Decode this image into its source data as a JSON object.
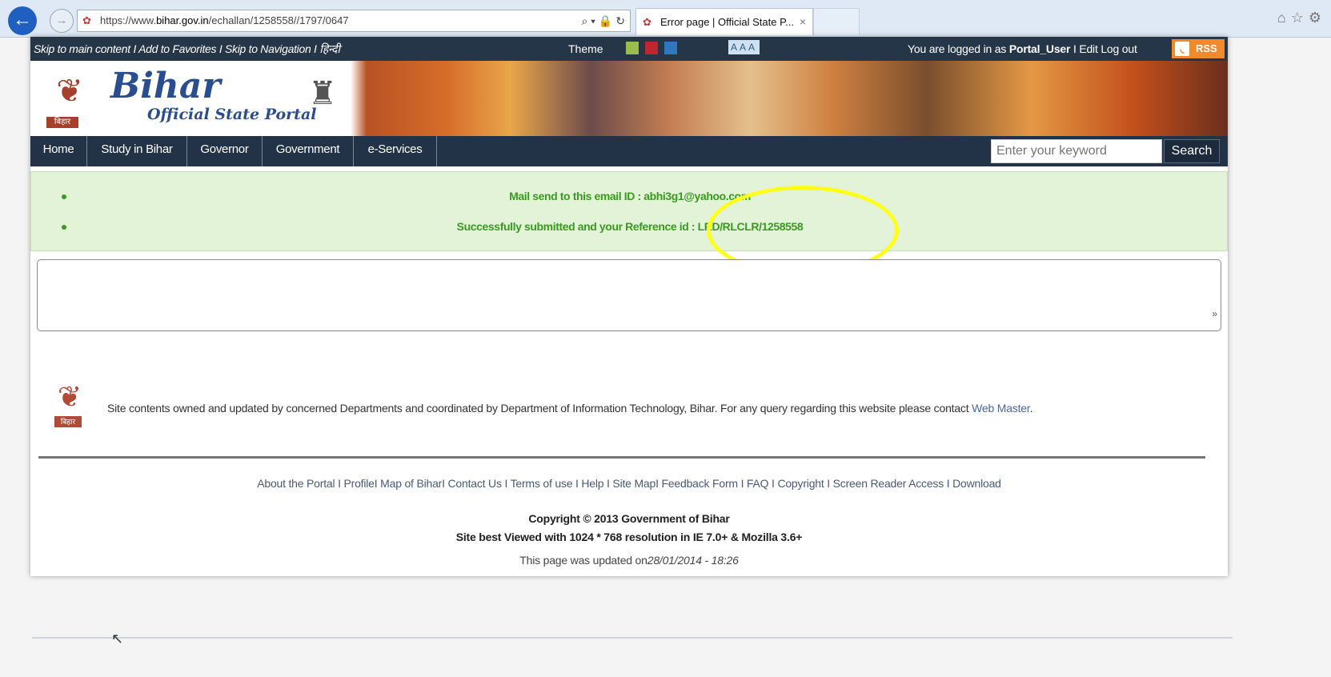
{
  "browser": {
    "url_prefix": "https://www.",
    "url_domain": "bihar.gov.in",
    "url_path": "/echallan/1258558//1797/0647",
    "tab_title": "Error page | Official State P...",
    "tab_close": "×",
    "back_icon": "arrow-left-icon",
    "address_tools": "⌕ ▾ 🔒 ↻"
  },
  "topbar": {
    "skip_links": "Skip to main content I Add to Favorites I Skip to Navigation I हिन्दी",
    "theme_label": "Theme",
    "theme_colors": [
      "#9bbd4a",
      "#c0262d",
      "#2f78bf"
    ],
    "font_sizes": "AAA",
    "logged_prefix": "You are logged in as ",
    "logged_user": "Portal_User",
    "logged_suffix": " I Edit  Log out",
    "rss_label": "RSS"
  },
  "banner": {
    "title": "Bihar",
    "subtitle": "Official State Portal",
    "logo_label": "बिहार"
  },
  "nav": {
    "items": [
      "Home",
      "Study in Bihar",
      "Governor",
      "Government",
      "e-Services"
    ],
    "search_placeholder": "Enter your keyword",
    "search_button": "Search"
  },
  "messages": {
    "mail_sent": "Mail send to this email ID : abhi3g1@yahoo.com",
    "submitted_prefix": "Successfully submitted and your Reference id : ",
    "reference_id": "LRD/RLCLR/1258558"
  },
  "panel": {
    "arrow": "»"
  },
  "footer": {
    "logo_label": "बिहार",
    "site_owned": "Site contents owned and updated by concerned Departments and coordinated by Department of Information Technology, Bihar. For any query regarding this website please contact ",
    "web_master": "Web Master",
    "site_owned_end": ".",
    "links": "About the Portal I ProfileI Map of BiharI Contact Us I Terms of use I Help I Site MapI Feedback Form I FAQ I Copyright I Screen Reader Access I Download",
    "copyright": "Copyright © 2013 Government of Bihar",
    "best_viewed": "Site best Viewed with 1024 * 768 resolution in IE 7.0+ & Mozilla 3.6+",
    "updated_prefix": "This page was updated on",
    "updated_date": "28/01/2014 - 18:26"
  }
}
